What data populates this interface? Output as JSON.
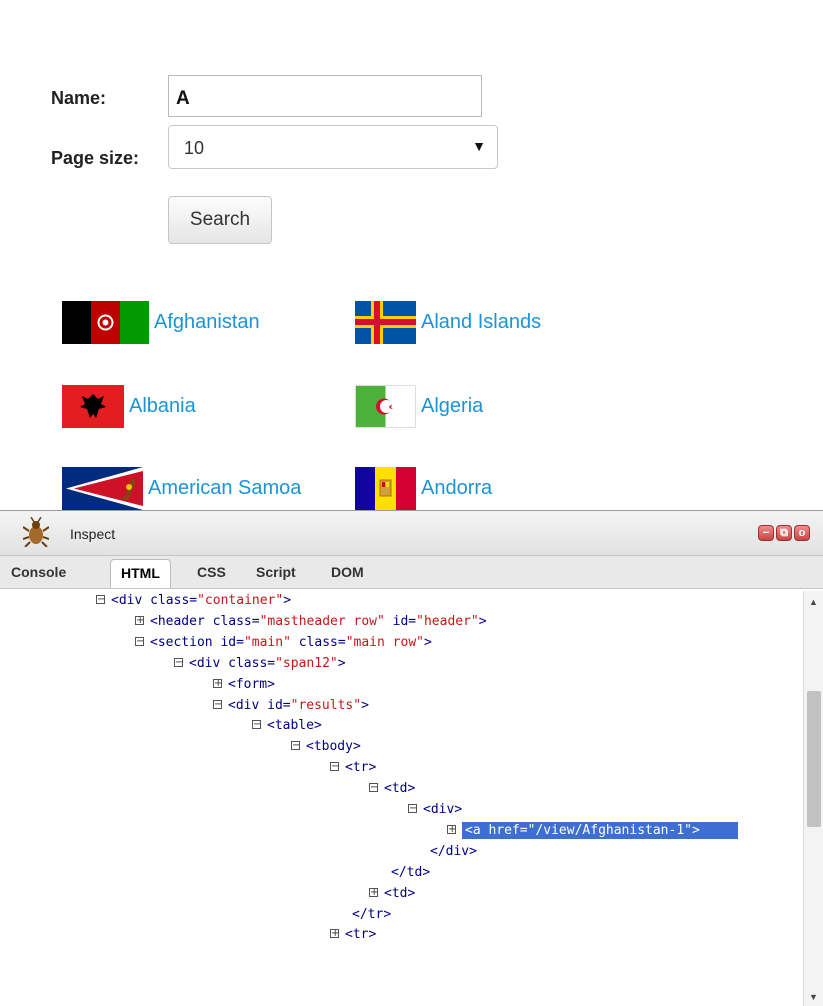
{
  "form": {
    "name_label": "Name:",
    "name_value": "A",
    "pagesize_label": "Page size:",
    "pagesize_value": "10",
    "search_label": "Search"
  },
  "countries": [
    {
      "name": "Afghanistan"
    },
    {
      "name": "Aland Islands"
    },
    {
      "name": "Albania"
    },
    {
      "name": "Algeria"
    },
    {
      "name": "American Samoa"
    },
    {
      "name": "Andorra"
    }
  ],
  "devtools": {
    "title": "Inspect",
    "tabs": [
      "Console",
      "HTML",
      "CSS",
      "Script",
      "DOM"
    ],
    "active_tab": "HTML",
    "tree": [
      {
        "toggle": "−",
        "tag": "div",
        "attrs": [
          [
            "class",
            "container"
          ]
        ]
      },
      {
        "toggle": "+",
        "tag": "header",
        "attrs": [
          [
            "class",
            "mastheader row"
          ],
          [
            "id",
            "header"
          ]
        ]
      },
      {
        "toggle": "−",
        "tag": "section",
        "attrs": [
          [
            "id",
            "main"
          ],
          [
            "class",
            "main row"
          ]
        ]
      },
      {
        "toggle": "−",
        "tag": "div",
        "attrs": [
          [
            "class",
            "span12"
          ]
        ]
      },
      {
        "toggle": "+",
        "tag": "form",
        "attrs": []
      },
      {
        "toggle": "−",
        "tag": "div",
        "attrs": [
          [
            "id",
            "results"
          ]
        ]
      },
      {
        "toggle": "−",
        "tag": "table",
        "attrs": []
      },
      {
        "toggle": "−",
        "tag": "tbody",
        "attrs": []
      },
      {
        "toggle": "−",
        "tag": "tr",
        "attrs": []
      },
      {
        "toggle": "−",
        "tag": "td",
        "attrs": []
      },
      {
        "toggle": "−",
        "tag": "div",
        "attrs": []
      },
      {
        "toggle": "+",
        "tag": "a",
        "attrs": [
          [
            "href",
            "/view/Afghanistan-1"
          ]
        ],
        "selected": true
      },
      {
        "toggle": "",
        "tag": "/div",
        "attrs": []
      },
      {
        "toggle": "",
        "tag": "/td",
        "attrs": []
      },
      {
        "toggle": "+",
        "tag": "td",
        "attrs": []
      },
      {
        "toggle": "",
        "tag": "/tr",
        "attrs": []
      },
      {
        "toggle": "+",
        "tag": "tr",
        "attrs": []
      }
    ]
  }
}
